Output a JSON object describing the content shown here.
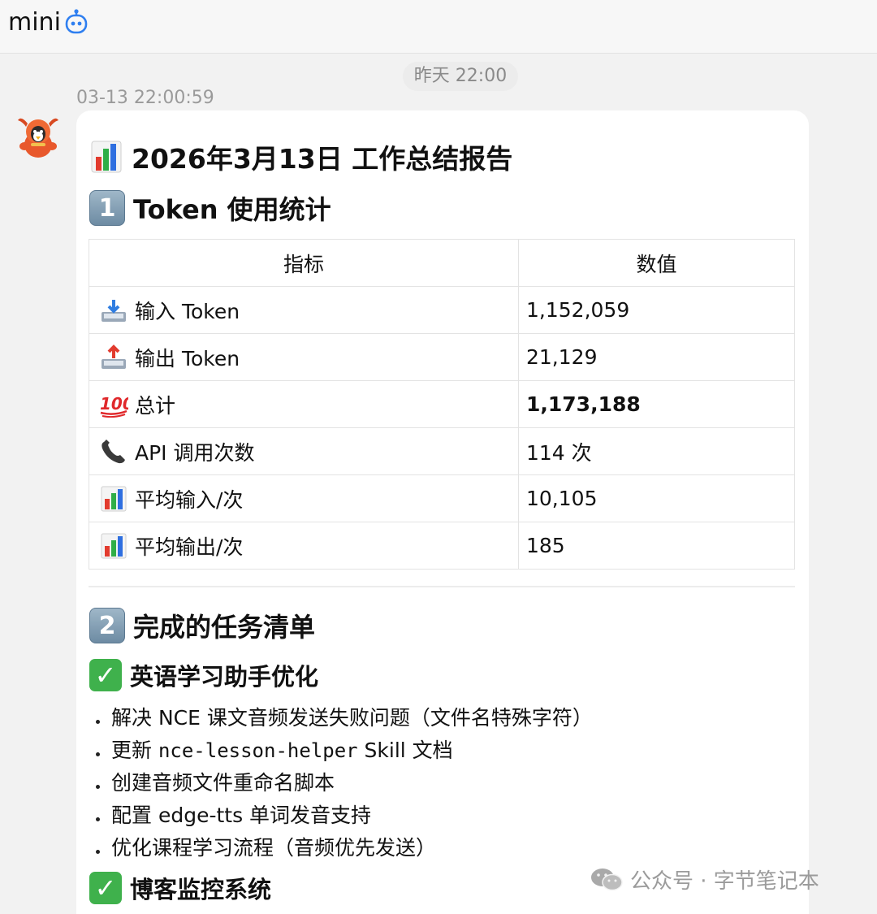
{
  "header": {
    "title": "mini",
    "bot_icon": "robot-icon"
  },
  "chat": {
    "day_separator": "昨天 22:00",
    "message_time": "03-13 22:00:59"
  },
  "report": {
    "title": "2026年3月13日 工作总结报告",
    "section1": {
      "number": "1",
      "title": "Token 使用统计"
    },
    "table": {
      "headers": [
        "指标",
        "数值"
      ],
      "rows": [
        {
          "icon": "inbox-tray-icon",
          "label": "输入 Token",
          "value": "1,152,059"
        },
        {
          "icon": "outbox-tray-icon",
          "label": "输出 Token",
          "value": "21,129"
        },
        {
          "icon": "hundred-points-icon",
          "label": "总计",
          "value": "1,173,188",
          "bold": true
        },
        {
          "icon": "telephone-receiver-icon",
          "label": "API 调用次数",
          "value": "114 次"
        },
        {
          "icon": "bar-chart-icon",
          "label": "平均输入/次",
          "value": "10,105"
        },
        {
          "icon": "bar-chart-icon",
          "label": "平均输出/次",
          "value": "185"
        }
      ]
    },
    "section2": {
      "number": "2",
      "title": "完成的任务清单"
    },
    "task_group1": {
      "title": "英语学习助手优化",
      "items": [
        {
          "text": "解决 NCE 课文音频发送失败问题（文件名特殊字符）"
        },
        {
          "pre": "更新 ",
          "code": "nce-lesson-helper",
          "post": " Skill 文档"
        },
        {
          "text": "创建音频文件重命名脚本"
        },
        {
          "text": "配置 edge-tts 单词发音支持"
        },
        {
          "text": "优化课程学习流程（音频优先发送）"
        }
      ]
    },
    "task_group2": {
      "title": "博客监控系统"
    }
  },
  "watermark": {
    "text": "公众号 · 字节笔记本"
  },
  "colors": {
    "check_green": "#3fb14c",
    "bubble_bg": "#ffffff",
    "page_bg": "#f2f2f2"
  }
}
